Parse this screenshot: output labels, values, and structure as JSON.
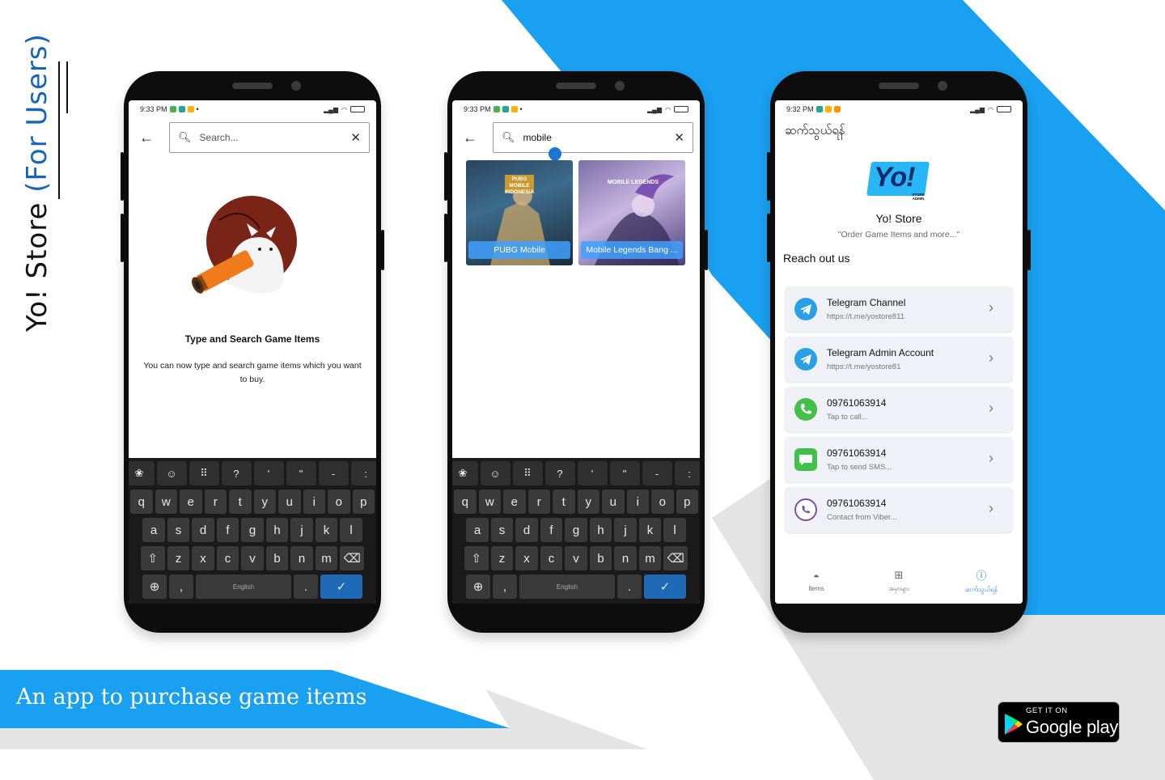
{
  "promo": {
    "title": "Yo! Store",
    "subtitle": "(For Users)",
    "tagline": "An app to purchase game items",
    "badge_line1": "GET IT ON",
    "badge_line2": "Google play"
  },
  "colors": {
    "accent": "#1aa0f0",
    "gray_shape": "#e4e4e4"
  },
  "screen1": {
    "time": "9:33 PM",
    "search_placeholder": "Search...",
    "empty_title": "Type and Search Game Items",
    "empty_desc": "You can now type and search game items which you want to buy."
  },
  "screen2": {
    "time": "9:33 PM",
    "search_value": "mobile",
    "results": [
      {
        "name": "PUBG Mobile",
        "art_text": "PUBG MOBILE INDONESIA"
      },
      {
        "name": "Mobile Legends Bang ...",
        "art_text": "MOBILE LEGENDS"
      }
    ]
  },
  "screen3": {
    "time": "9:32 PM",
    "header": "ဆက်သွယ်ရန်",
    "logo_text": "Yo!",
    "logo_sub": "STORE ADMIN",
    "app_name": "Yo! Store",
    "slogan": "\"Order Game Items and more...\"",
    "section": "Reach out us",
    "contacts": [
      {
        "title": "Telegram Channel",
        "sub": "https://t.me/yostore811",
        "icon": "telegram-icon"
      },
      {
        "title": "Telegram Admin Account",
        "sub": "https://t.me/yostore81",
        "icon": "telegram-icon"
      },
      {
        "title": "09761063914",
        "sub": "Tap to call...",
        "icon": "phone-icon"
      },
      {
        "title": "09761063914",
        "sub": "Tap to send SMS...",
        "icon": "sms-icon"
      },
      {
        "title": "09761063914",
        "sub": "Contact from Viber...",
        "icon": "viber-icon"
      }
    ],
    "nav": [
      {
        "label": "Items",
        "icon": "pokeball-icon"
      },
      {
        "label": "အမှာများ",
        "icon": "orders-icon"
      },
      {
        "label": "ဆက်သွယ်ရန်",
        "icon": "info-icon"
      }
    ]
  },
  "keyboard": {
    "row0": [
      "❀",
      "☺",
      "⠿",
      "?",
      "'",
      "\"",
      "-",
      ":"
    ],
    "row1": [
      "q",
      "w",
      "e",
      "r",
      "t",
      "y",
      "u",
      "i",
      "o",
      "p"
    ],
    "row2": [
      "a",
      "s",
      "d",
      "f",
      "g",
      "h",
      "j",
      "k",
      "l"
    ],
    "row3": [
      "⇧",
      "z",
      "x",
      "c",
      "v",
      "b",
      "n",
      "m",
      "⌫"
    ],
    "space_label": "English",
    "globe": "⊕",
    "comma": ",",
    "period": ".",
    "enter": "✓"
  }
}
